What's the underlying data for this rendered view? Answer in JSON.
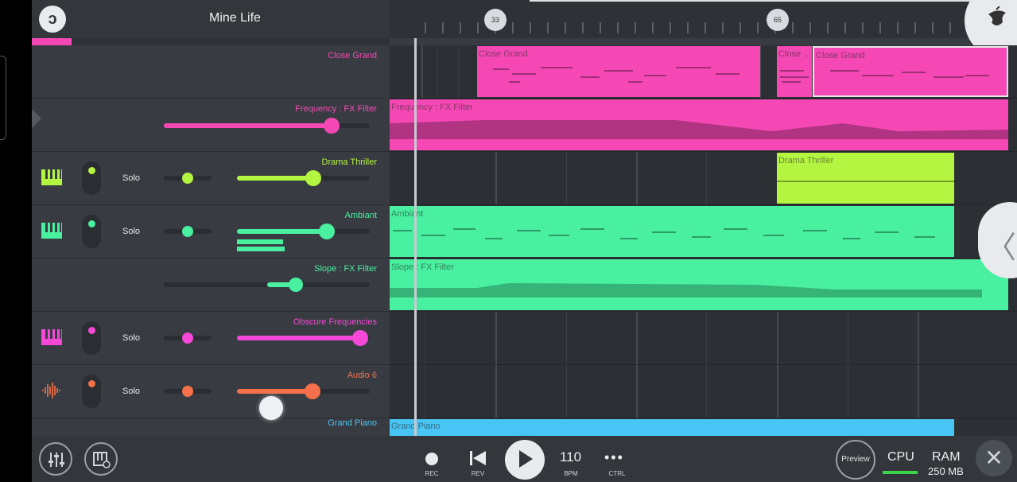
{
  "project": {
    "title": "Mine Life"
  },
  "ruler": {
    "markers": [
      "33",
      "65"
    ]
  },
  "tracks": [
    {
      "name": "Close Grand",
      "color": "#f548b4",
      "clips": [
        "Close Grand",
        "Close ...",
        "Close Grand"
      ]
    },
    {
      "name": "Frequency : FX Filter",
      "color": "#f548b4",
      "level": 0.82,
      "clip": "Frequency : FX Filter"
    },
    {
      "name": "Drama Thriller",
      "color": "#b4f542",
      "solo": "Solo",
      "volume": 0.58,
      "clip": "Drama Thriller"
    },
    {
      "name": "Ambiant",
      "color": "#48f0a0",
      "solo": "Solo",
      "volume": 0.68,
      "clip": "Ambiant"
    },
    {
      "name": "Slope : FX Filter",
      "color": "#48f0a0",
      "level": 0.64,
      "clip": "Slope : FX Filter"
    },
    {
      "name": "Obscure Frequencies",
      "color": "#f548d8",
      "solo": "Solo",
      "volume": 0.93
    },
    {
      "name": "Audio 6",
      "color": "#f5704a",
      "solo": "Solo",
      "volume": 0.57
    },
    {
      "name": "Grand Piano",
      "color": "#48c4f5",
      "clip": "Grand Piano"
    }
  ],
  "transport": {
    "rec": "REC",
    "rev": "REV",
    "bpm": "110",
    "bpm_label": "BPM",
    "ctrl": "CTRL",
    "ctrl_dots": "•••"
  },
  "status": {
    "preview": "Preview",
    "cpu": "CPU",
    "ram": "RAM",
    "ram_value": "250 MB",
    "close": "✕"
  },
  "icons": [
    "mixer-icon",
    "piano-settings-icon",
    "fl-fruit-logo",
    "chevron-left-icon"
  ]
}
